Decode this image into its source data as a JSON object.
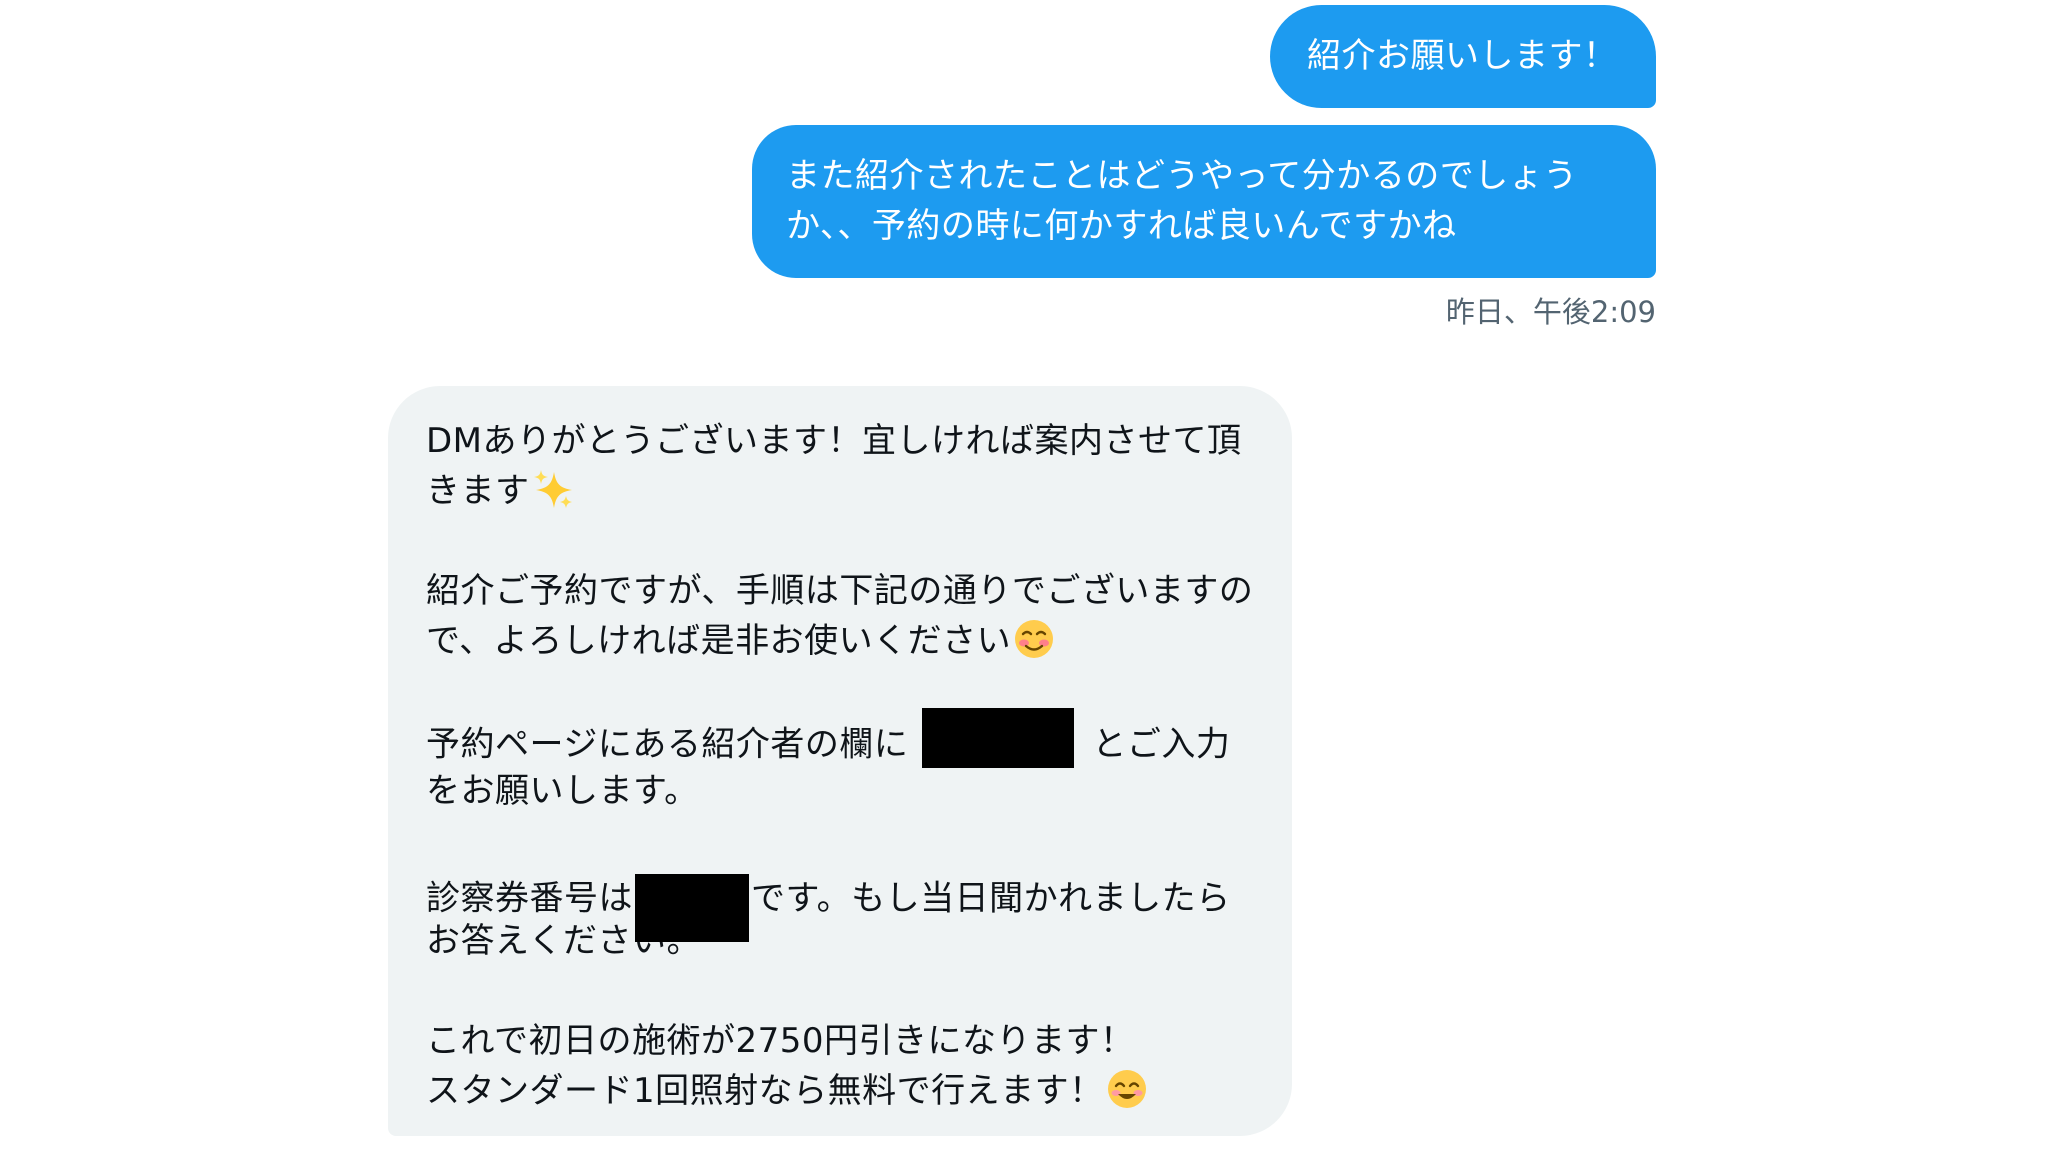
{
  "messages": {
    "sent_1": {
      "text": "紹介お願いします！"
    },
    "sent_2": {
      "line_1": "また紹介されたことはどうやって分かるのでしょう",
      "line_2": "か、、予約の時に何かすれば良いんですかね"
    },
    "timestamp": "昨日、午後2:09",
    "received": {
      "p1_line_1": "DMありがとうございます！宜しければ案内させて頂",
      "p1_line_2": "きます",
      "p2_line_1": "紹介ご予約ですが、手順は下記の通りでございますの",
      "p2_line_2": "で、よろしければ是非お使いください",
      "p3_line_1_a": "予約ページにある紹介者の欄に",
      "p3_line_1_b": "とご入力",
      "p3_line_2": "をお願いします。",
      "p4_line_1_a": "診察券番号は",
      "p4_line_1_b": "です。もし当日聞かれましたら",
      "p4_line_2": "お答えください。",
      "p5_line_1": "これで初日の施術が2750円引きになります！",
      "p5_line_2": "スタンダード1回照射なら無料で行えます！"
    }
  },
  "icons": {
    "sparkles": "sparkles-icon",
    "smiling_blush": "smiling-face-blush-icon",
    "smiling_eyes": "smiling-face-eyes-icon"
  },
  "colors": {
    "sent_bubble": "#1d9bf0",
    "received_bubble": "#eff3f4",
    "timestamp_text": "#536471",
    "redaction": "#000000"
  }
}
